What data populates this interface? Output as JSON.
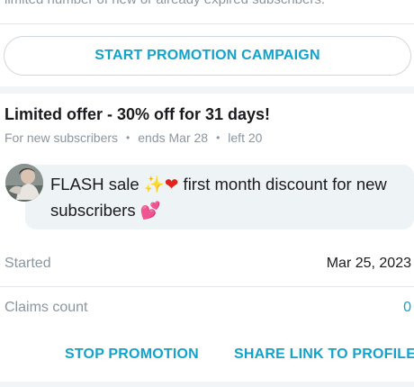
{
  "top": {
    "truncated_text": "limited number of new or already expired subscribers."
  },
  "campaign": {
    "start_button_label": "START PROMOTION CAMPAIGN"
  },
  "offer": {
    "title": "Limited offer - 30% off for 31 days!",
    "audience": "For new subscribers",
    "ends": "ends Mar 28",
    "left": "left 20",
    "separator": "•"
  },
  "message": {
    "part1": "FLASH sale ",
    "emoji1": "✨",
    "emoji2": "❤",
    "part2": " first month discount for new subscribers ",
    "emoji3": "💕"
  },
  "details": {
    "started_label": "Started",
    "started_value": "Mar 25, 2023",
    "claims_label": "Claims count",
    "claims_value": "0"
  },
  "actions": {
    "stop_label": "STOP PROMOTION",
    "share_label": "SHARE LINK TO PROFILE"
  },
  "colors": {
    "accent": "#13a2cc",
    "muted": "#8a96a0",
    "bubble": "#eef3f6"
  }
}
